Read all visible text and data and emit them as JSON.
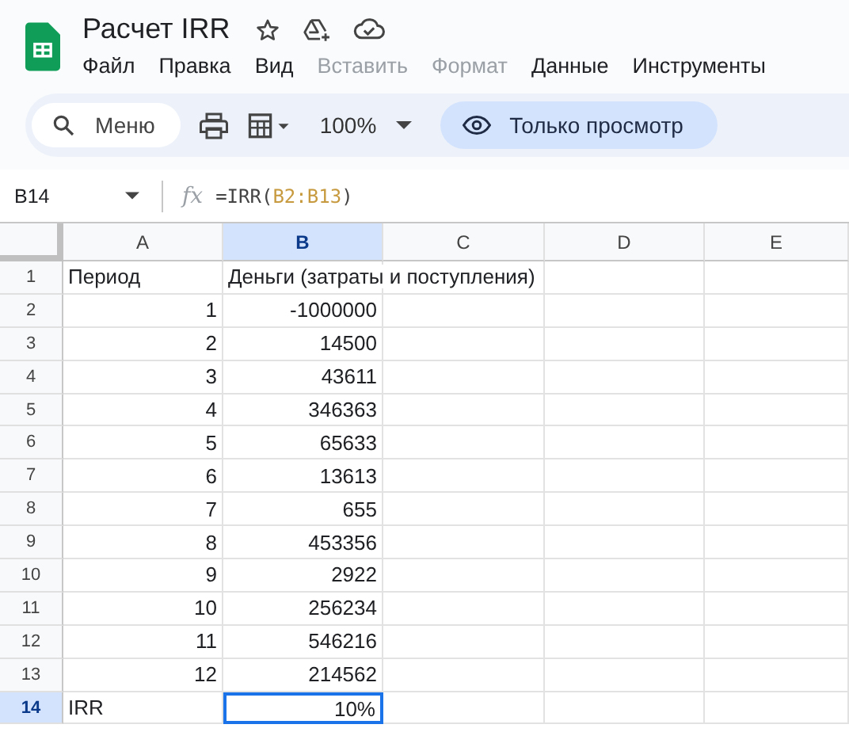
{
  "document": {
    "title": "Расчет IRR"
  },
  "menu": [
    {
      "label": "Файл",
      "disabled": false
    },
    {
      "label": "Правка",
      "disabled": false
    },
    {
      "label": "Вид",
      "disabled": false
    },
    {
      "label": "Вставить",
      "disabled": true
    },
    {
      "label": "Формат",
      "disabled": true
    },
    {
      "label": "Данные",
      "disabled": false
    },
    {
      "label": "Инструменты",
      "disabled": false
    }
  ],
  "toolbar": {
    "search_placeholder": "Меню",
    "zoom": "100%",
    "mode_button": "Только просмотр"
  },
  "formula_bar": {
    "cell_ref": "B14",
    "function_label": "fx",
    "formula_start": "=IRR(",
    "formula_range": "B2:B13",
    "formula_end": ")"
  },
  "columns": [
    {
      "label": "A",
      "selected": false
    },
    {
      "label": "B",
      "selected": true
    },
    {
      "label": "C",
      "selected": false
    },
    {
      "label": "D",
      "selected": false
    },
    {
      "label": "E",
      "selected": false
    }
  ],
  "rows": [
    {
      "number": "1",
      "selected": false,
      "cells": [
        {
          "text": "Период",
          "kind": "text",
          "selected": false
        },
        {
          "text": "Деньги (затраты и поступления)",
          "kind": "text",
          "selected": false
        }
      ]
    },
    {
      "number": "2",
      "selected": false,
      "cells": [
        {
          "text": "1",
          "kind": "number",
          "selected": false
        },
        {
          "text": "-1000000",
          "kind": "number",
          "selected": false
        }
      ]
    },
    {
      "number": "3",
      "selected": false,
      "cells": [
        {
          "text": "2",
          "kind": "number",
          "selected": false
        },
        {
          "text": "14500",
          "kind": "number",
          "selected": false
        }
      ]
    },
    {
      "number": "4",
      "selected": false,
      "cells": [
        {
          "text": "3",
          "kind": "number",
          "selected": false
        },
        {
          "text": "43611",
          "kind": "number",
          "selected": false
        }
      ]
    },
    {
      "number": "5",
      "selected": false,
      "cells": [
        {
          "text": "4",
          "kind": "number",
          "selected": false
        },
        {
          "text": "346363",
          "kind": "number",
          "selected": false
        }
      ]
    },
    {
      "number": "6",
      "selected": false,
      "cells": [
        {
          "text": "5",
          "kind": "number",
          "selected": false
        },
        {
          "text": "65633",
          "kind": "number",
          "selected": false
        }
      ]
    },
    {
      "number": "7",
      "selected": false,
      "cells": [
        {
          "text": "6",
          "kind": "number",
          "selected": false
        },
        {
          "text": "13613",
          "kind": "number",
          "selected": false
        }
      ]
    },
    {
      "number": "8",
      "selected": false,
      "cells": [
        {
          "text": "7",
          "kind": "number",
          "selected": false
        },
        {
          "text": "655",
          "kind": "number",
          "selected": false
        }
      ]
    },
    {
      "number": "9",
      "selected": false,
      "cells": [
        {
          "text": "8",
          "kind": "number",
          "selected": false
        },
        {
          "text": "453356",
          "kind": "number",
          "selected": false
        }
      ]
    },
    {
      "number": "10",
      "selected": false,
      "cells": [
        {
          "text": "9",
          "kind": "number",
          "selected": false
        },
        {
          "text": "2922",
          "kind": "number",
          "selected": false
        }
      ]
    },
    {
      "number": "11",
      "selected": false,
      "cells": [
        {
          "text": "10",
          "kind": "number",
          "selected": false
        },
        {
          "text": "256234",
          "kind": "number",
          "selected": false
        }
      ]
    },
    {
      "number": "12",
      "selected": false,
      "cells": [
        {
          "text": "11",
          "kind": "number",
          "selected": false
        },
        {
          "text": "546216",
          "kind": "number",
          "selected": false
        }
      ]
    },
    {
      "number": "13",
      "selected": false,
      "cells": [
        {
          "text": "12",
          "kind": "number",
          "selected": false
        },
        {
          "text": "214562",
          "kind": "number",
          "selected": false
        }
      ]
    },
    {
      "number": "14",
      "selected": true,
      "cells": [
        {
          "text": "IRR",
          "kind": "text",
          "selected": false
        },
        {
          "text": "10%",
          "kind": "number",
          "selected": true
        }
      ]
    }
  ]
}
